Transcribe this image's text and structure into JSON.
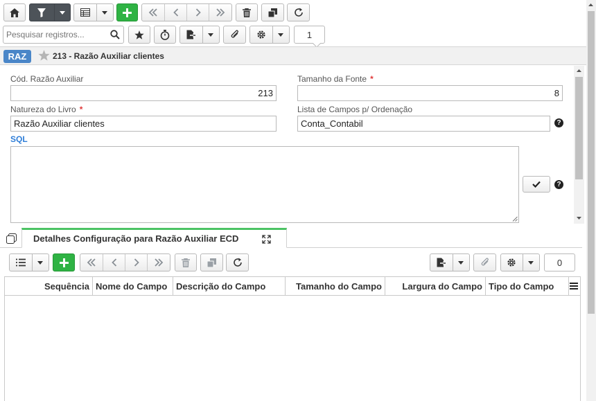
{
  "toolbar": {
    "counter_value": "1"
  },
  "search": {
    "placeholder": "Pesquisar registros..."
  },
  "record": {
    "badge": "RAZ",
    "title": "213 - Razão Auxiliar clientes"
  },
  "form": {
    "cod_label": "Cód. Razão Auxiliar",
    "cod_value": "213",
    "tamanho_label": "Tamanho da Fonte",
    "tamanho_value": "8",
    "natureza_label": "Natureza do Livro",
    "natureza_value": "Razão Auxiliar clientes",
    "lista_label": "Lista de Campos p/ Ordenação",
    "lista_value": "Conta_Contabil",
    "sql_label": "SQL",
    "sql_value": "",
    "required_mark": "*"
  },
  "detail": {
    "tab_label": "Detalhes Configuração para Razão Auxiliar ECD",
    "counter_value": "0",
    "columns": [
      "Sequência",
      "Nome do Campo",
      "Descrição do Campo",
      "Tamanho do Campo",
      "Largura do Campo",
      "Tipo do Campo"
    ]
  },
  "colors": {
    "accent_green": "#2fb344",
    "badge_blue": "#4a86c8",
    "sql_blue": "#2f7ed8",
    "required_red": "#e03a3a",
    "tab_green": "#4cc364"
  },
  "icons": [
    "home-icon",
    "filter-icon",
    "table-icon",
    "plus-icon",
    "first-icon",
    "prev-icon",
    "next-icon",
    "last-icon",
    "trash-icon",
    "copy-icon",
    "refresh-icon",
    "search-icon",
    "star-icon",
    "stopwatch-icon",
    "export-icon",
    "paperclip-icon",
    "gear-icon",
    "check-icon",
    "help-icon",
    "expand-icon",
    "list-icon",
    "menu-icon",
    "windows-icon"
  ]
}
